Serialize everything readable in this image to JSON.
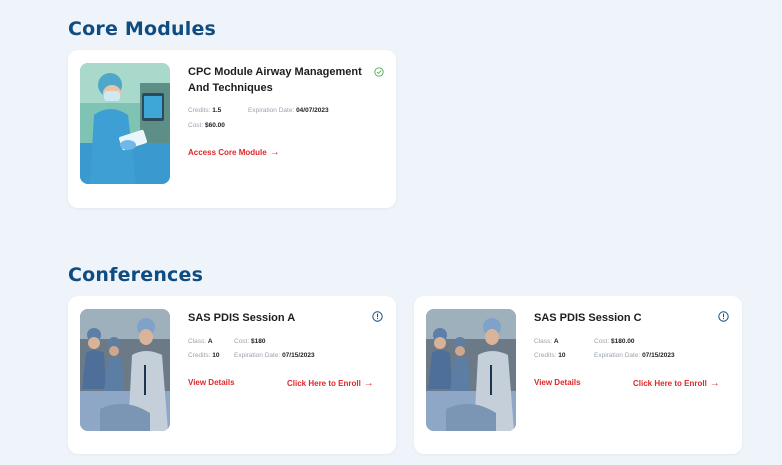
{
  "sections": {
    "core_title": "Core Modules",
    "conf_title": "Conferences"
  },
  "core_card": {
    "title_line1": "CPC Module Airway Management",
    "title_line2": "And Techniques",
    "credits_label": "Credits:",
    "credits_value": "1.5",
    "expiration_label": "Expiration Date:",
    "expiration_value": "04/07/2023",
    "cost_label": "Cost:",
    "cost_value": "$60.00",
    "action_label": "Access Core Module",
    "status_icon": "check-circle-icon",
    "status_color": "#4caf50"
  },
  "conferences": [
    {
      "title": "SAS PDIS Session A",
      "class_label": "Class:",
      "class_value": "A",
      "cost_label": "Cost:",
      "cost_value": "$180",
      "credits_label": "Credits:",
      "credits_value": "10",
      "expiration_label": "Expiration Date:",
      "expiration_value": "07/15/2023",
      "details_label": "View Details",
      "enroll_label": "Click Here to Enroll",
      "status_icon": "info-circle-icon"
    },
    {
      "title": "SAS PDIS Session C",
      "class_label": "Class:",
      "class_value": "A",
      "cost_label": "Cost:",
      "cost_value": "$180.00",
      "credits_label": "Credits:",
      "credits_value": "10",
      "expiration_label": "Expiration Date:",
      "expiration_value": "07/15/2023",
      "details_label": "View Details",
      "enroll_label": "Click Here to Enroll",
      "status_icon": "info-circle-icon"
    }
  ],
  "colors": {
    "accent_blue": "#0f4c81",
    "link_red": "#e0262b",
    "background": "#eef4f9"
  }
}
